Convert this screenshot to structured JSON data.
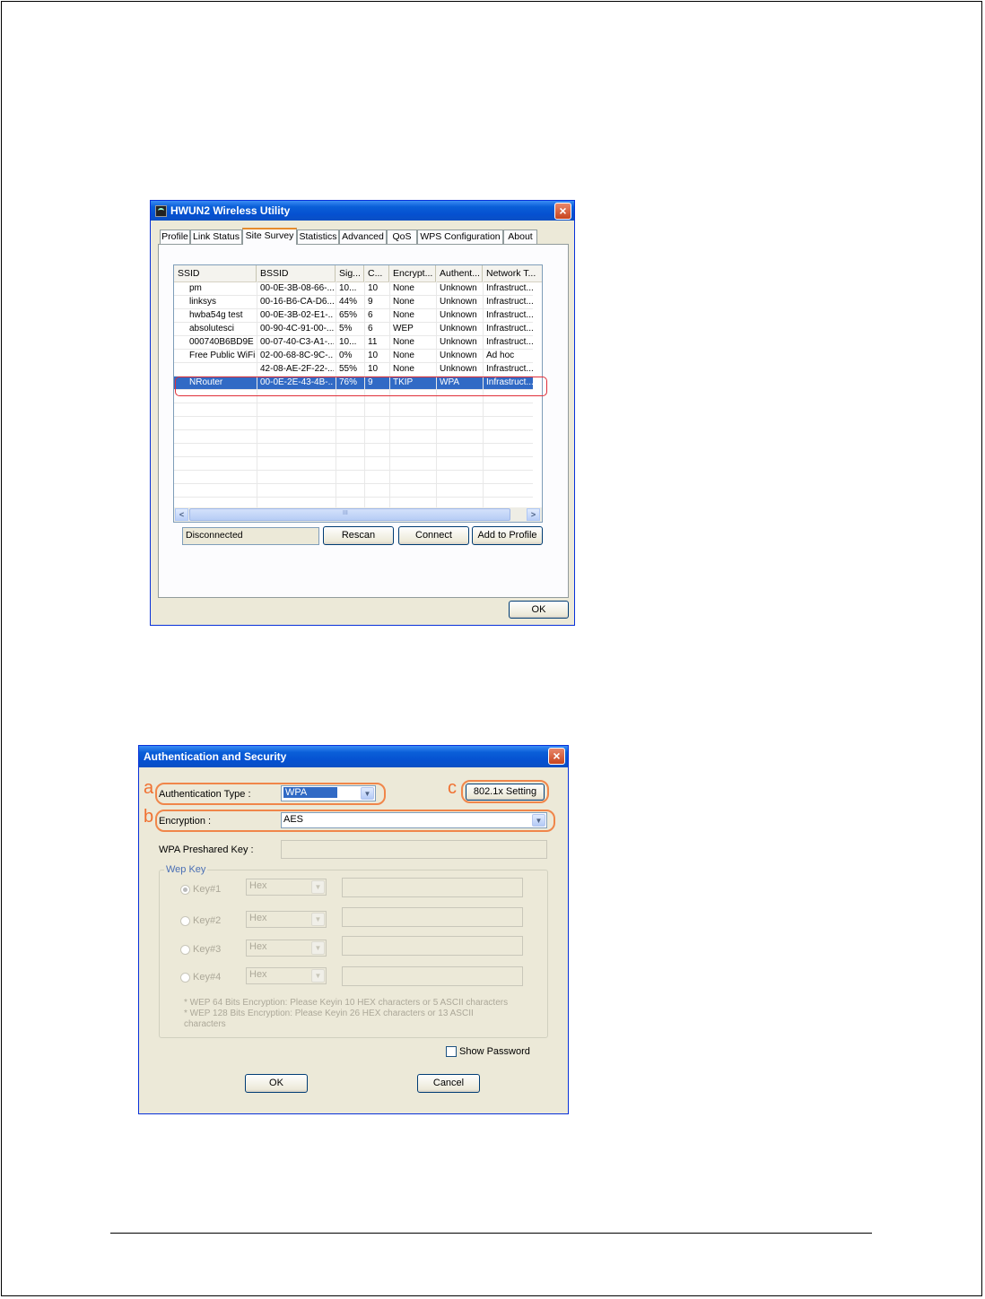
{
  "utility": {
    "title": "HWUN2 Wireless Utility",
    "tabs": [
      "Profile",
      "Link Status",
      "Site Survey",
      "Statistics",
      "Advanced",
      "QoS",
      "WPS Configuration",
      "About"
    ],
    "active_tab": "Site Survey",
    "columns": [
      "SSID",
      "BSSID",
      "Sig...",
      "C...",
      "Encrypt...",
      "Authent...",
      "Network T..."
    ],
    "rows": [
      [
        "pm",
        "00-0E-3B-08-66-...",
        "10...",
        "10",
        "None",
        "Unknown",
        "Infrastruct..."
      ],
      [
        "linksys",
        "00-16-B6-CA-D6...",
        "44%",
        "9",
        "None",
        "Unknown",
        "Infrastruct..."
      ],
      [
        "hwba54g test",
        "00-0E-3B-02-E1-...",
        "65%",
        "6",
        "None",
        "Unknown",
        "Infrastruct..."
      ],
      [
        "absolutesci",
        "00-90-4C-91-00-...",
        "5%",
        "6",
        "WEP",
        "Unknown",
        "Infrastruct..."
      ],
      [
        "000740B6BD9E",
        "00-07-40-C3-A1-...",
        "10...",
        "11",
        "None",
        "Unknown",
        "Infrastruct..."
      ],
      [
        "Free Public WiFi",
        "02-00-68-8C-9C-...",
        "0%",
        "10",
        "None",
        "Unknown",
        "Ad hoc"
      ],
      [
        "",
        "42-08-AE-2F-22-...",
        "55%",
        "10",
        "None",
        "Unknown",
        "Infrastruct..."
      ],
      [
        "NRouter",
        "00-0E-2E-43-4B-...",
        "76%",
        "9",
        "TKIP",
        "WPA",
        "Infrastruct..."
      ]
    ],
    "selected_row": "NRouter",
    "status": "Disconnected",
    "buttons": {
      "rescan": "Rescan",
      "connect": "Connect",
      "add_to_profile": "Add to Profile",
      "ok": "OK"
    },
    "scroll_arrow_left": "<",
    "scroll_arrow_right": ">",
    "scroll_grip": "III"
  },
  "auth": {
    "title": "Authentication and Security",
    "auth_type_label": "Authentication Type :",
    "auth_type_value": "WPA",
    "setting_button": "802.1x Setting",
    "encryption_label": "Encryption :",
    "encryption_value": "AES",
    "psk_label": "WPA Preshared Key :",
    "psk_value": "",
    "wep_group_label": "Wep Key",
    "keys": [
      {
        "label": "Key#1",
        "format": "Hex",
        "checked": true
      },
      {
        "label": "Key#2",
        "format": "Hex",
        "checked": false
      },
      {
        "label": "Key#3",
        "format": "Hex",
        "checked": false
      },
      {
        "label": "Key#4",
        "format": "Hex",
        "checked": false
      }
    ],
    "note_1": "* WEP 64 Bits Encryption:  Please Keyin 10 HEX characters or 5 ASCII characters",
    "note_2": "* WEP 128 Bits Encryption:  Please Keyin 26 HEX characters or 13 ASCII",
    "note_3": "characters",
    "show_password_label": "Show Password",
    "ok": "OK",
    "cancel": "Cancel",
    "markers": {
      "a": "a",
      "b": "b",
      "c": "c"
    }
  },
  "colors": {
    "highlight_red": "#e0303a",
    "highlight_orange": "#f0864a",
    "selection": "#316ac5"
  }
}
